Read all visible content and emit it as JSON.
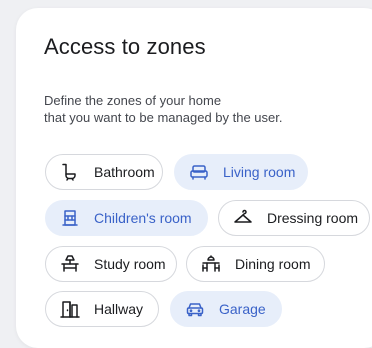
{
  "card": {
    "title": "Access to zones",
    "description_lines": [
      "Define the zones of your home",
      "that you want to be managed by the user."
    ]
  },
  "zones": [
    {
      "label": "Bathroom",
      "icon": "bathtub-icon",
      "selected": false
    },
    {
      "label": "Living room",
      "icon": "sofa-icon",
      "selected": true
    },
    {
      "label": "Children's room",
      "icon": "crib-icon",
      "selected": true
    },
    {
      "label": "Dressing room",
      "icon": "hanger-icon",
      "selected": false
    },
    {
      "label": "Study room",
      "icon": "desk-lamp-icon",
      "selected": false
    },
    {
      "label": "Dining room",
      "icon": "dining-table-icon",
      "selected": false
    },
    {
      "label": "Hallway",
      "icon": "door-icon",
      "selected": false
    },
    {
      "label": "Garage",
      "icon": "car-icon",
      "selected": true
    }
  ],
  "colors": {
    "selected_bg": "#e7eefa",
    "selected_text": "#3a62c8",
    "chip_border": "#d6d8dd",
    "text": "#1b1c1f"
  }
}
